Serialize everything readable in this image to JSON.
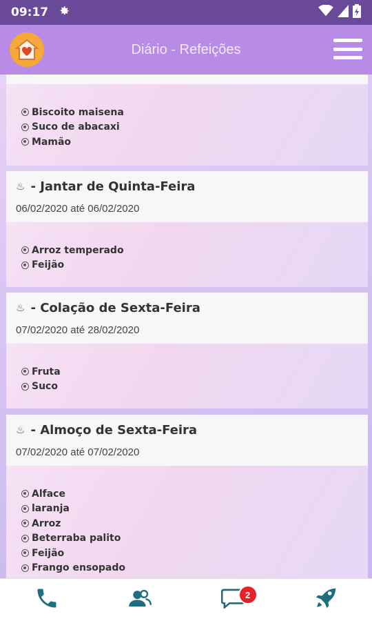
{
  "status": {
    "time": "09:17"
  },
  "header": {
    "title": "Diário - Refeições"
  },
  "cards": [
    {
      "title": "",
      "dates": "",
      "items": [
        "Biscoito maisena",
        "Suco de abacaxi",
        "Mamão"
      ]
    },
    {
      "title": "- Jantar  de Quinta-Feira",
      "dates": "06/02/2020 até 06/02/2020",
      "items": [
        "Arroz temperado",
        "Feijão"
      ]
    },
    {
      "title": "- Colação de Sexta-Feira",
      "dates": "07/02/2020 até 28/02/2020",
      "items": [
        "Fruta",
        "Suco"
      ]
    },
    {
      "title": "- Almoço de Sexta-Feira",
      "dates": "07/02/2020 até 07/02/2020",
      "items": [
        "Alface",
        "laranja",
        "Arroz",
        "Beterraba palito",
        "Feijão",
        "Frango ensopado"
      ]
    }
  ],
  "bottom_nav": {
    "items": [
      "phone-icon",
      "contacts-icon",
      "chat-icon",
      "rocket-icon"
    ],
    "chat_badge": "2"
  },
  "colors": {
    "appbar": "#b78be6",
    "statusbar": "#6a4a98",
    "accent_icons": "#1f6e7e",
    "badge": "#e7202a"
  }
}
